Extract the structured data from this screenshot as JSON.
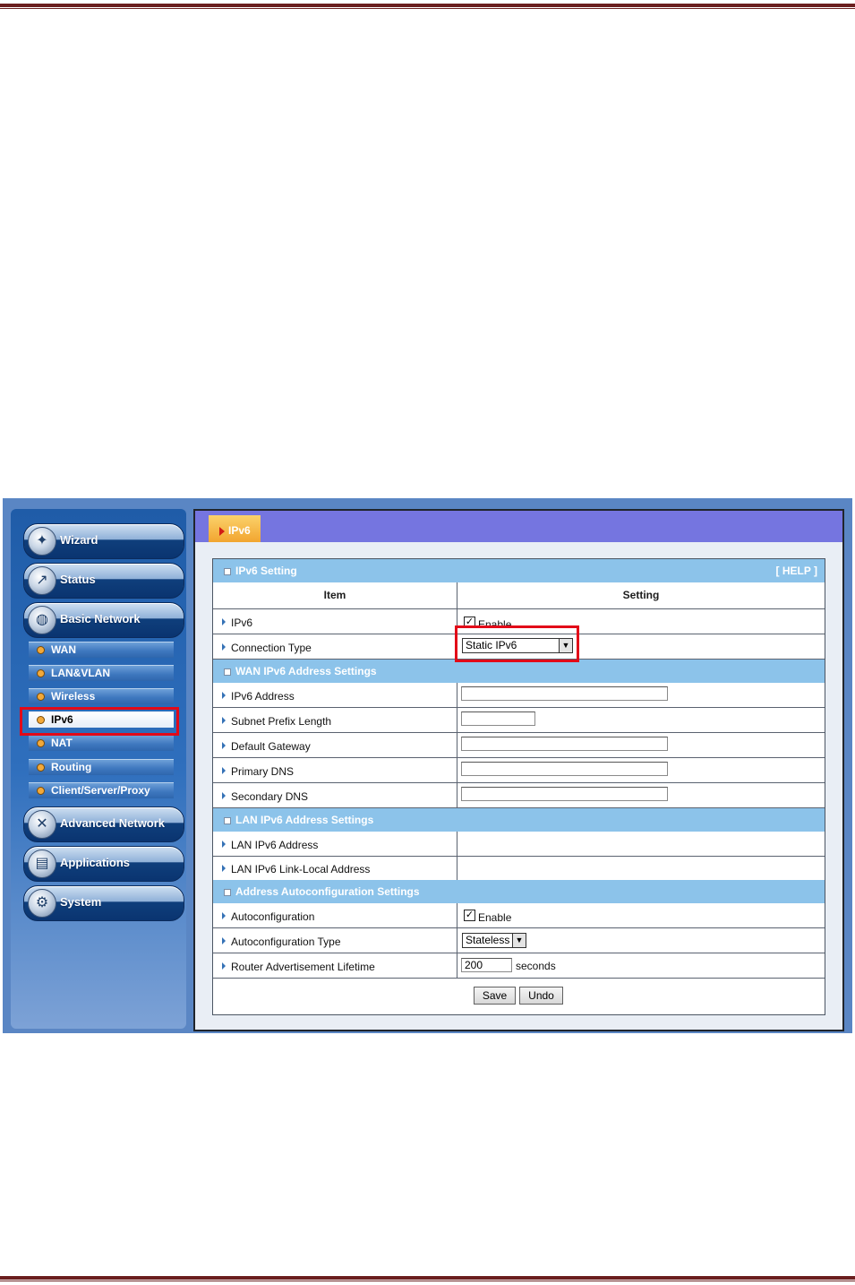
{
  "sidebar": {
    "main_items": [
      {
        "label": "Wizard",
        "icon": "wand-icon"
      },
      {
        "label": "Status",
        "icon": "chart-icon"
      },
      {
        "label": "Basic Network",
        "icon": "globe-icon"
      },
      {
        "label": "Advanced Network",
        "icon": "tools-icon"
      },
      {
        "label": "Applications",
        "icon": "apps-icon"
      },
      {
        "label": "System",
        "icon": "system-icon"
      }
    ],
    "sub_items": [
      "WAN",
      "LAN&VLAN",
      "Wireless",
      "IPv6",
      "NAT",
      "Routing",
      "Client/Server/Proxy"
    ],
    "active_sub": "IPv6"
  },
  "banner": {
    "tab_label": "IPv6"
  },
  "panel": {
    "section_ipv6": "IPv6 Setting",
    "help": "[ HELP ]",
    "col_item": "Item",
    "col_setting": "Setting",
    "ipv6_label": "IPv6",
    "ipv6_enable_label": "Enable",
    "ipv6_enabled": true,
    "conn_type_label": "Connection Type",
    "conn_type_value": "Static IPv6",
    "section_wan": "WAN IPv6 Address Settings",
    "ipv6_address_label": "IPv6 Address",
    "ipv6_address_value": "",
    "subnet_prefix_label": "Subnet Prefix Length",
    "subnet_prefix_value": "",
    "default_gateway_label": "Default Gateway",
    "default_gateway_value": "",
    "primary_dns_label": "Primary DNS",
    "primary_dns_value": "",
    "secondary_dns_label": "Secondary DNS",
    "secondary_dns_value": "",
    "section_lan": "LAN IPv6 Address Settings",
    "lan_ipv6_address_label": "LAN IPv6 Address",
    "lan_ipv6_linklocal_label": "LAN IPv6 Link-Local Address",
    "section_auto": "Address Autoconfiguration Settings",
    "autoconf_label": "Autoconfiguration",
    "autoconf_enable_label": "Enable",
    "autoconf_enabled": true,
    "autoconf_type_label": "Autoconfiguration Type",
    "autoconf_type_value": "Stateless",
    "ra_lifetime_label": "Router Advertisement Lifetime",
    "ra_lifetime_value": "200",
    "ra_lifetime_unit": "seconds",
    "save_label": "Save",
    "undo_label": "Undo"
  },
  "colors": {
    "highlight": "#e20a18",
    "banner": "#7575e0",
    "section": "#8cc3ea",
    "tab": "#f2a530"
  }
}
